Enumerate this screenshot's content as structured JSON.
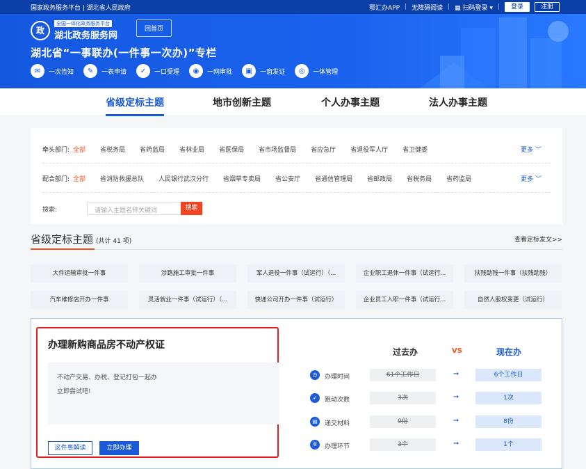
{
  "topbar": {
    "left": "国家政务服务平台 | 湖北省人民政府",
    "app": "鄂汇办APP",
    "access": "无障碍阅读",
    "scan": "扫码登录",
    "login": "登录",
    "register": "注册"
  },
  "hero": {
    "logo_small": "全国一体化政务服务平台",
    "logo_big": "湖北政务服务网",
    "home": "回首页",
    "title": "湖北省“一事联办(一件事一次办)”专栏",
    "features": [
      {
        "icon": "notice-icon",
        "label": "一次告知"
      },
      {
        "icon": "form-icon",
        "label": "一表申请"
      },
      {
        "icon": "accept-icon",
        "label": "一口受理"
      },
      {
        "icon": "review-icon",
        "label": "一网审批"
      },
      {
        "icon": "cert-icon",
        "label": "一窗发证"
      },
      {
        "icon": "manage-icon",
        "label": "一体管理"
      }
    ]
  },
  "tabs": [
    "省级定标主题",
    "地市创新主题",
    "个人办事主题",
    "法人办事主题"
  ],
  "filters": {
    "lead_label": "牵头部门:",
    "lead": [
      "全部",
      "省税务局",
      "省药监局",
      "省林业局",
      "省医保局",
      "省市场监督局",
      "省应急厅",
      "省退役军人厅",
      "省卫健委"
    ],
    "coop_label": "配合部门:",
    "coop": [
      "全部",
      "省消防救援总队",
      "人民银行武汉分行",
      "省烟草专卖局",
      "省公安厅",
      "省通信管理局",
      "省邮政局",
      "省税务局",
      "省药监局"
    ],
    "more": "更多",
    "search_label": "搜索:",
    "search_placeholder": "请输入主题名称关键词",
    "search_btn": "搜索"
  },
  "section": {
    "title": "省级定标主题",
    "count": "(共计 41 项)",
    "more": "查看定标发文>>"
  },
  "topics": [
    "大件运输审批一件事",
    "涉路施工审批一件事",
    "军人退役一件事（试运行）（...",
    "企业职工退休一件事（试运行...",
    "扶残助残一件事（扶残助残）",
    "汽车维修店开办一件事",
    "灵活就业一件事（试运行）（...",
    "快递公司开办一件事（试运行）",
    "企业员工入职一件事（试运行...",
    "自然人股权变更（试运行）"
  ],
  "card": {
    "title": "办理新购商品房不动产权证",
    "desc1": "不动产交易、办税、登记打包一起办",
    "desc2": "立即尝试吧!",
    "btn_explain": "这件事解读",
    "btn_do": "立即办理",
    "head_old": "过去办",
    "head_vs": "VS",
    "head_new": "现在办",
    "rows": [
      {
        "icon": "clock-icon",
        "name": "办理时间",
        "old": "61个工作日",
        "new": "6个工作日"
      },
      {
        "icon": "run-icon",
        "name": "跑动次数",
        "old": "3次",
        "new": "1次"
      },
      {
        "icon": "doc-icon",
        "name": "递交材料",
        "old": "9份",
        "new": "8份"
      },
      {
        "icon": "step-icon",
        "name": "办理环节",
        "old": "3个",
        "new": "1个"
      }
    ]
  },
  "colors": {
    "primary": "#1a5ad8",
    "accent": "#ee5522",
    "highlight": "#e21e1e"
  }
}
